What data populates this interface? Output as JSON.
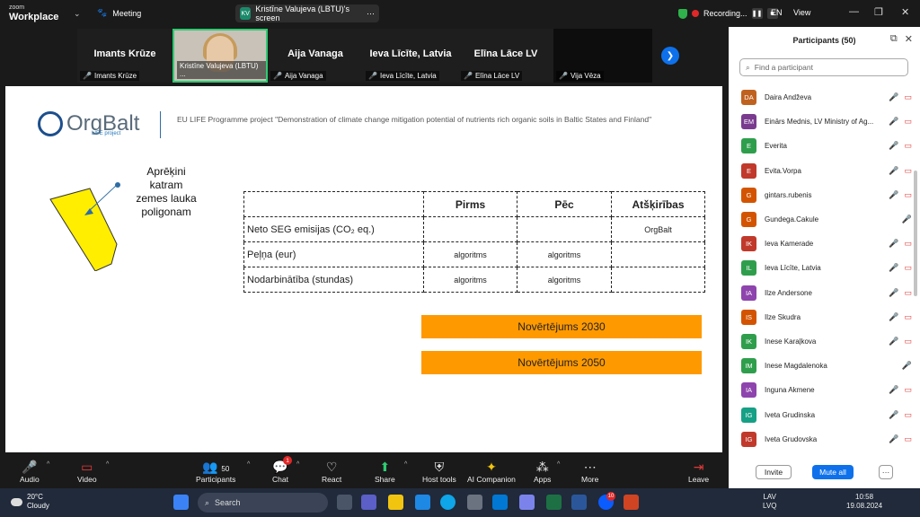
{
  "app": {
    "brand_top": "zoom",
    "brand_bottom": "Workplace",
    "meeting_label": "Meeting"
  },
  "share": {
    "initials": "KV",
    "label": "Kristīne Valujeva (LBTU)'s screen"
  },
  "recording": {
    "label": "Recording...",
    "lang": "EN",
    "view": "View"
  },
  "gallery": [
    {
      "name": "Imants Krūze",
      "label": "Imants Krūze"
    },
    {
      "name": "",
      "label": "Kristīne Valujeva (LBTU) ..."
    },
    {
      "name": "Aija Vanaga",
      "label": "Aija Vanaga"
    },
    {
      "name": "Ieva Līcīte, Latvia",
      "label": "Ieva Līcīte, Latvia"
    },
    {
      "name": "Elīna Lāce LV",
      "label": "Elīna Lāce LV"
    },
    {
      "name": "",
      "label": "Vija Vēza"
    }
  ],
  "slide": {
    "logo_text": "OrgBalt",
    "logo_sub": "LIFE project",
    "project": "EU LIFE Programme project \"Demonstration of climate change mitigation potential of nutrients rich organic soils in Baltic States and Finland\"",
    "calc": [
      "Aprēķini",
      "katram",
      "zemes lauka",
      "poligonam"
    ],
    "table": {
      "headers": [
        "",
        "Pirms",
        "Pēc",
        "Atšķirības"
      ],
      "rows": [
        [
          "Neto SEG emisijas (CO₂ eq.)",
          "",
          "",
          "OrgBalt"
        ],
        [
          "Peļņa (eur)",
          "algoritms",
          "algoritms",
          ""
        ],
        [
          "Nodarbinātība (stundas)",
          "algoritms",
          "algoritms",
          ""
        ]
      ]
    },
    "est2030": "Novērtējums 2030",
    "est2050": "Novērtējums 2050"
  },
  "participants": {
    "title": "Participants (50)",
    "search_placeholder": "Find a participant",
    "list": [
      {
        "initials": "DA",
        "name": "Daira Andževa",
        "color": "#c0621f",
        "video": true
      },
      {
        "initials": "EM",
        "name": "Einārs Mednis, LV Ministry of Ag...",
        "color": "#7a3b8f",
        "video": true
      },
      {
        "initials": "E",
        "name": "Everita",
        "color": "#2f9e4c",
        "video": true
      },
      {
        "initials": "E",
        "name": "Evita.Vorpa",
        "color": "#c0392b",
        "video": true
      },
      {
        "initials": "G",
        "name": "gintars.rubenis",
        "color": "#d35400",
        "video": true
      },
      {
        "initials": "G",
        "name": "Gundega.Cakule",
        "color": "#d35400",
        "video": false
      },
      {
        "initials": "IK",
        "name": "Ieva Kamerade",
        "color": "#c0392b",
        "video": true
      },
      {
        "initials": "IL",
        "name": "Ieva Līcīte, Latvia",
        "color": "#2f9e4c",
        "video": true
      },
      {
        "initials": "IA",
        "name": "Ilze Andersone",
        "color": "#8e44ad",
        "video": true
      },
      {
        "initials": "IS",
        "name": "Ilze Skudra",
        "color": "#d35400",
        "video": true
      },
      {
        "initials": "IK",
        "name": "Inese Karaļkova",
        "color": "#2f9e4c",
        "video": true
      },
      {
        "initials": "IM",
        "name": "Inese Magdalenoka",
        "color": "#2f9e4c",
        "video": false
      },
      {
        "initials": "IA",
        "name": "Inguna Akmene",
        "color": "#8e44ad",
        "video": true
      },
      {
        "initials": "IG",
        "name": "Iveta Grudinska",
        "color": "#16a085",
        "video": true
      },
      {
        "initials": "IG",
        "name": "Iveta Grudovska",
        "color": "#c0392b",
        "video": true
      }
    ],
    "invite": "Invite",
    "mute_all": "Mute all",
    "more": "···"
  },
  "toolbar": {
    "audio": "Audio",
    "video": "Video",
    "participants": "Participants",
    "participants_count": "50",
    "chat": "Chat",
    "chat_badge": "1",
    "react": "React",
    "share": "Share",
    "host_tools": "Host tools",
    "ai": "AI Companion",
    "apps": "Apps",
    "more": "More",
    "leave": "Leave"
  },
  "taskbar": {
    "temp": "20°C",
    "weather": "Cloudy",
    "search": "Search",
    "lang1": "LAV",
    "lang2": "LVQ",
    "time": "10:58",
    "date": "19.08.2024",
    "zoom_badge": "10"
  }
}
